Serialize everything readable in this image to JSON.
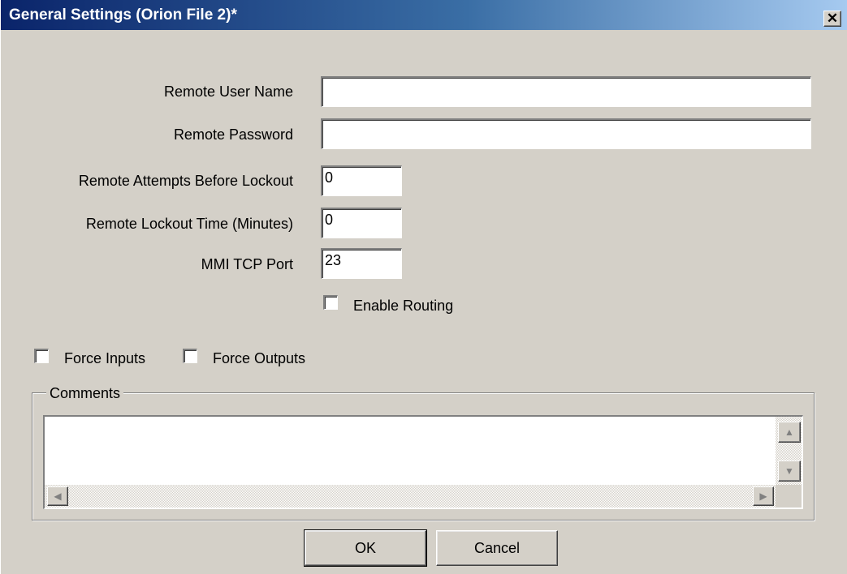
{
  "window": {
    "title": "General Settings (Orion File 2)*",
    "close_glyph": "✕"
  },
  "fields": {
    "remote_user_name": {
      "label": "Remote User Name",
      "value": ""
    },
    "remote_password": {
      "label": "Remote Password",
      "value": ""
    },
    "remote_attempts": {
      "label": "Remote Attempts Before Lockout",
      "value": "0"
    },
    "remote_lockout_time": {
      "label": "Remote Lockout Time (Minutes)",
      "value": "0"
    },
    "mmi_tcp_port": {
      "label": "MMI TCP Port",
      "value": "23"
    }
  },
  "checkboxes": {
    "enable_routing": {
      "label": "Enable Routing",
      "checked": false
    },
    "force_inputs": {
      "label": "Force Inputs",
      "checked": false
    },
    "force_outputs": {
      "label": "Force Outputs",
      "checked": false
    }
  },
  "comments": {
    "label": "Comments",
    "value": ""
  },
  "scroll_glyphs": {
    "up": "▲",
    "down": "▼",
    "left": "◀",
    "right": "▶"
  },
  "buttons": {
    "ok": "OK",
    "cancel": "Cancel"
  },
  "colors": {
    "titlebar_start": "#0a246a",
    "titlebar_end": "#a6caf0",
    "dialog_bg": "#d4d0c8"
  }
}
